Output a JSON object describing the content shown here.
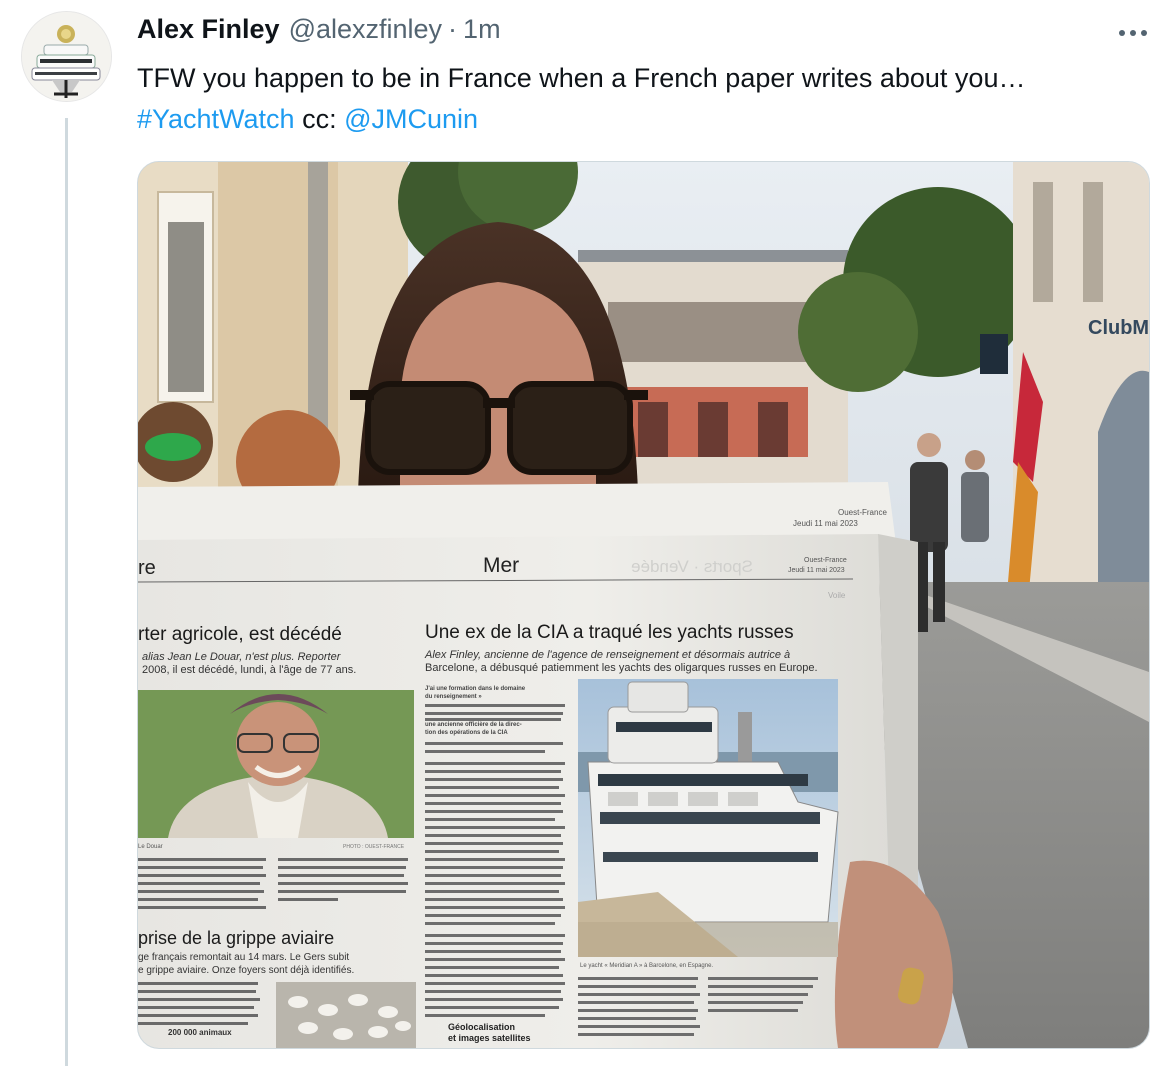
{
  "tweet": {
    "author": {
      "display_name": "Alex Finley",
      "handle": "@alexzfinley",
      "avatar_icon": "yacht-avatar-icon"
    },
    "separator": "·",
    "timestamp": "1m",
    "more_icon": "more-icon",
    "text": {
      "line1": "TFW you happen to be in France when a French paper writes about you…",
      "hashtag": "#YachtWatch",
      "cc_label": " cc: ",
      "mention": "@JMCunin"
    },
    "colors": {
      "link": "#1d9bf0",
      "text": "#0f1419",
      "muted": "#536471",
      "border": "#cfd9de"
    }
  },
  "photo": {
    "newspaper_back": {
      "paper": "Ouest-France",
      "date": "Jeudi 11 mai 2023",
      "section_mirrored": "Sports · Vendée",
      "section_right": "Voile"
    },
    "newspaper_front": {
      "section_left": "re",
      "section": "Mer",
      "paper": "Ouest-France",
      "date": "Jeudi 11 mai 2023",
      "left_headline": "rter agricole, est décédé",
      "left_lede_1": "alias Jean Le Douar, n'est plus. Reporter",
      "left_lede_2": "2008, il est décédé, lundi, à l'âge de 77 ans.",
      "photo_caption_left": "Le Douar",
      "photo_credit": "PHOTO : OUEST-FRANCE",
      "left_headline_2": "prise de la grippe aviaire",
      "left_lede_3": "ge français remontait au 14 mars. Le Gers subit",
      "left_lede_4": "e grippe aviaire. Onze foyers sont déjà identifiés.",
      "left_footer": "200 000 animaux",
      "main_headline": "Une ex de la CIA a traqué les yachts russes",
      "main_lede_1": "Alex Finley, ancienne de l'agence de renseignement et désormais autrice à",
      "main_lede_2": "Barcelone, a débusqué patiemment les yachts des oligarques russes en Europe.",
      "subhead": "Géolocalisation",
      "subhead_2": "et images satellites",
      "yacht_caption": "Le yacht « Meridian A » à Barcelone, en Espagne.",
      "column_bold_1": "J'ai une formation dans le domaine",
      "column_bold_2": "du renseignement »",
      "column_bold_3": "une ancienne officière de la direc-",
      "column_bold_4": "tion des opérations de la CIA"
    },
    "storefront_sign": "ClubMed"
  }
}
